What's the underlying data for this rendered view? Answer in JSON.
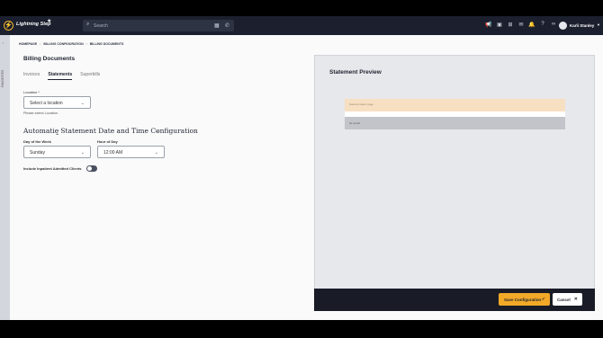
{
  "app": {
    "name": "Lightning Step",
    "logo_letter": "⚡"
  },
  "topbar": {
    "search_placeholder": "Search",
    "user_name": "Karli Stanley"
  },
  "sidebar": {
    "vertical_label": "FAVORITES"
  },
  "breadcrumb": [
    "HOMEPAGE",
    "BILLING CONFIGURATION",
    "BILLING DOCUMENTS"
  ],
  "page": {
    "title": "Billing Documents"
  },
  "tabs": [
    {
      "label": "Invoices",
      "active": false
    },
    {
      "label": "Statements",
      "active": true
    },
    {
      "label": "Superbills",
      "active": false
    }
  ],
  "location": {
    "label": "Location *",
    "selected": "Select a location",
    "help": "Please select Location."
  },
  "section": {
    "title": "Automatic Statement Date and Time Configuration"
  },
  "day": {
    "label": "Day of the Week",
    "selected": "Sunday"
  },
  "hour": {
    "label": "Hour of Day",
    "selected": "12:00 AM"
  },
  "toggle": {
    "label": "Include Inpatient Admitted Clients",
    "on": false
  },
  "preview": {
    "title": "Statement Preview",
    "band1": "Statement data on page",
    "band2": "No records"
  },
  "footer": {
    "save_label": "Save Configuration",
    "cancel_label": "Cancel"
  },
  "colors": {
    "accent": "#f2a928",
    "appbar": "#1b1f2e"
  }
}
